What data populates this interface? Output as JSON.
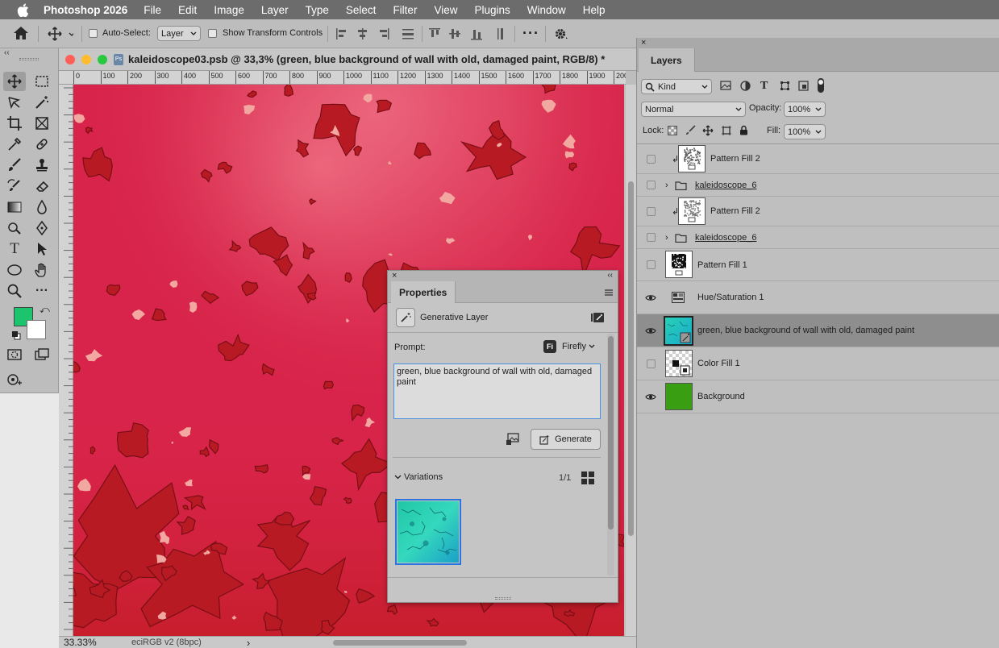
{
  "menubar": {
    "app_name": "Photoshop 2026",
    "items": [
      "File",
      "Edit",
      "Image",
      "Layer",
      "Type",
      "Select",
      "Filter",
      "View",
      "Plugins",
      "Window",
      "Help"
    ]
  },
  "options": {
    "auto_select_label": "Auto-Select:",
    "auto_select_value": "Layer",
    "transform_label": "Show Transform Controls"
  },
  "document": {
    "title": "kaleidoscope03.psb @ 33,3% (green, blue background of wall with old, damaged paint, RGB/8) *",
    "ruler_ticks": [
      "0",
      "100",
      "200",
      "300",
      "400",
      "500",
      "600",
      "700",
      "800",
      "900",
      "1000",
      "1100",
      "1200",
      "1300",
      "1400",
      "1500",
      "1600",
      "1700",
      "1800",
      "1900",
      "200"
    ],
    "zoom": "33.33%",
    "color_profile": "eciRGB v2 (8bpc)",
    "status_arrow": "›"
  },
  "colors": {
    "foreground": "#1dc46e",
    "background": "#ffffff",
    "canvas_base": "#d8244a"
  },
  "properties": {
    "tab": "Properties",
    "layer_type": "Generative Layer",
    "prompt_label": "Prompt:",
    "model_badge": "Fi",
    "model": "Firefly",
    "prompt_text": "green, blue background of wall with old, damaged paint",
    "generate_label": "Generate",
    "variations_label": "Variations",
    "variations_count": "1/1"
  },
  "layers_panel": {
    "tab": "Layers",
    "filter_kind": "Kind",
    "blend_mode": "Normal",
    "opacity_label": "Opacity:",
    "opacity_value": "100%",
    "lock_label": "Lock:",
    "fill_label": "Fill:",
    "fill_value": "100%",
    "layers": [
      {
        "name": "Pattern Fill 2",
        "visible": false,
        "kind": "pattern-fill",
        "clipped": true
      },
      {
        "name": "kaleidoscope_6",
        "visible": false,
        "kind": "group"
      },
      {
        "name": "Pattern Fill 2",
        "visible": false,
        "kind": "pattern-fill",
        "clipped": true
      },
      {
        "name": "kaleidoscope_6",
        "visible": false,
        "kind": "group"
      },
      {
        "name": "Pattern Fill 1",
        "visible": false,
        "kind": "pattern-fill"
      },
      {
        "name": "Hue/Saturation 1",
        "visible": true,
        "kind": "adjustment"
      },
      {
        "name": "green, blue background of wall with old, damaged paint",
        "visible": true,
        "kind": "generative",
        "selected": true
      },
      {
        "name": "Color Fill 1",
        "visible": false,
        "kind": "color-fill"
      },
      {
        "name": "Background",
        "visible": true,
        "kind": "background",
        "color": "#3a9e12"
      }
    ]
  }
}
